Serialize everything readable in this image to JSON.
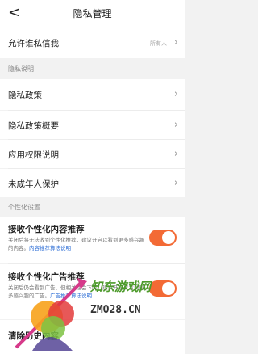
{
  "nav": {
    "title": "隐私管理",
    "back": "<"
  },
  "items": {
    "allow_message": {
      "label": "允许谁私信我",
      "value": "所有人"
    },
    "privacy_section": "隐私说明",
    "privacy_policy": "隐私政策",
    "privacy_summary": "隐私政策概要",
    "app_permissions": "应用权限说明",
    "minor_protection": "未成年人保护",
    "personal_section": "个性化设置",
    "content_rec": {
      "title": "接收个性化内容推荐",
      "desc": "关闭后将无法收到个性化推荐，建议开启以看到更多感兴趣的内容。",
      "link": "内容推荐算法说明"
    },
    "ad_rec": {
      "title": "接收个性化广告推荐",
      "desc": "关闭后仍会看到广告，但相关性会下降，建议开启以看到更多感兴趣的广告。",
      "link": "广告推荐算法说明"
    },
    "clear_history": "清除历史内容"
  },
  "watermark": {
    "brand": "知东游戏网",
    "domain": "ZMO28.CN"
  },
  "colors": {
    "toggle_on": "#f36a35",
    "link": "#2f6fd6",
    "chevron": "#999999"
  }
}
